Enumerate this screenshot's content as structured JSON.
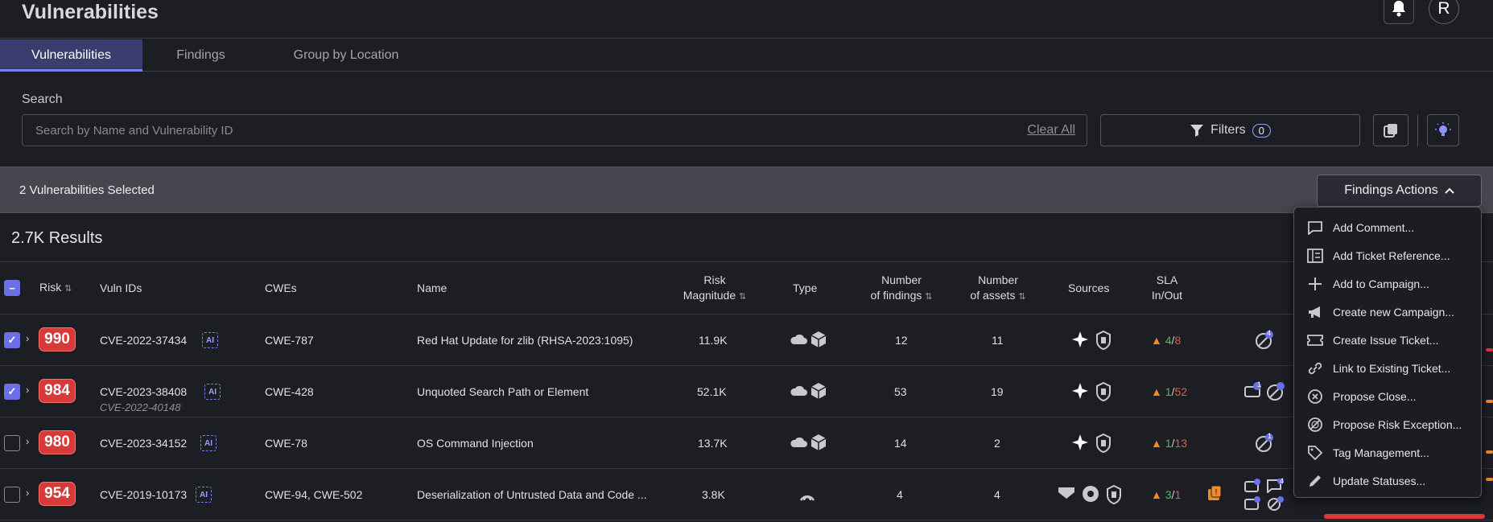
{
  "header": {
    "title": "Vulnerabilities",
    "avatar_initial": "R"
  },
  "tabs": [
    {
      "label": "Vulnerabilities",
      "active": true
    },
    {
      "label": "Findings",
      "active": false
    },
    {
      "label": "Group by Location",
      "active": false
    }
  ],
  "search": {
    "label": "Search",
    "placeholder": "Search by Name and Vulnerability ID",
    "value": "",
    "clear_label": "Clear All"
  },
  "filters": {
    "label": "Filters",
    "count": "0"
  },
  "selection": {
    "text": "2 Vulnerabilities Selected",
    "actions_label": "Findings Actions"
  },
  "results": {
    "text": "2.7K Results"
  },
  "columns": {
    "risk": "Risk",
    "vuln_ids": "Vuln IDs",
    "cwes": "CWEs",
    "name": "Name",
    "risk_magnitude_1": "Risk",
    "risk_magnitude_2": "Magnitude",
    "type": "Type",
    "findings_1": "Number",
    "findings_2": "of findings",
    "assets_1": "Number",
    "assets_2": "of assets",
    "sources": "Sources",
    "sla_1": "SLA",
    "sla_2": "In/Out"
  },
  "rows": [
    {
      "selected": true,
      "risk": "990",
      "vuln_id": "CVE-2022-37434",
      "vuln_sub": "",
      "ai": "AI",
      "cwes": "CWE-787",
      "name": "Red Hat Update for zlib (RHSA-2023:1095)",
      "risk_magnitude": "11.9K",
      "findings": "12",
      "assets": "11",
      "sla_in": "4",
      "sla_out": "8",
      "sla_sep": "/",
      "badge": "4"
    },
    {
      "selected": true,
      "risk": "984",
      "vuln_id": "CVE-2023-38408",
      "vuln_sub": "CVE-2022-40148",
      "ai": "AI",
      "cwes": "CWE-428",
      "name": "Unquoted Search Path or Element",
      "risk_magnitude": "52.1K",
      "findings": "53",
      "assets": "19",
      "sla_in": "1",
      "sla_out": "52",
      "sla_sep": "/",
      "badge": "1"
    },
    {
      "selected": false,
      "risk": "980",
      "vuln_id": "CVE-2023-34152",
      "vuln_sub": "",
      "ai": "AI",
      "cwes": "CWE-78",
      "name": "OS Command Injection",
      "risk_magnitude": "13.7K",
      "findings": "14",
      "assets": "2",
      "sla_in": "1",
      "sla_out": "13",
      "sla_sep": "/",
      "badge": "1"
    },
    {
      "selected": false,
      "risk": "954",
      "vuln_id": "CVE-2019-10173",
      "vuln_sub": "",
      "ai": "AI",
      "cwes": "CWE-94, CWE-502",
      "name": "Deserialization of Untrusted Data and Code ...",
      "risk_magnitude": "3.8K",
      "findings": "4",
      "assets": "4",
      "sla_in": "3",
      "sla_out": "1",
      "sla_sep": "/",
      "badge": "4"
    }
  ],
  "menu": [
    {
      "label": "Add Comment...",
      "icon": "comment-icon"
    },
    {
      "label": "Add Ticket Reference...",
      "icon": "ticket-reference-icon"
    },
    {
      "label": "Add to Campaign...",
      "icon": "plus-icon"
    },
    {
      "label": "Create new Campaign...",
      "icon": "megaphone-icon"
    },
    {
      "label": "Create Issue Ticket...",
      "icon": "ticket-icon"
    },
    {
      "label": "Link to Existing Ticket...",
      "icon": "link-icon"
    },
    {
      "label": "Propose Close...",
      "icon": "close-circle-icon"
    },
    {
      "label": "Propose Risk Exception...",
      "icon": "risk-exception-icon"
    },
    {
      "label": "Tag Management...",
      "icon": "tag-icon"
    },
    {
      "label": "Update Statuses...",
      "icon": "pencil-icon"
    }
  ],
  "colors": {
    "accent": "#6b6fe8",
    "risk": "#d63a3a",
    "tab_active": "#3a3e6e",
    "warning": "#f08a2c"
  }
}
